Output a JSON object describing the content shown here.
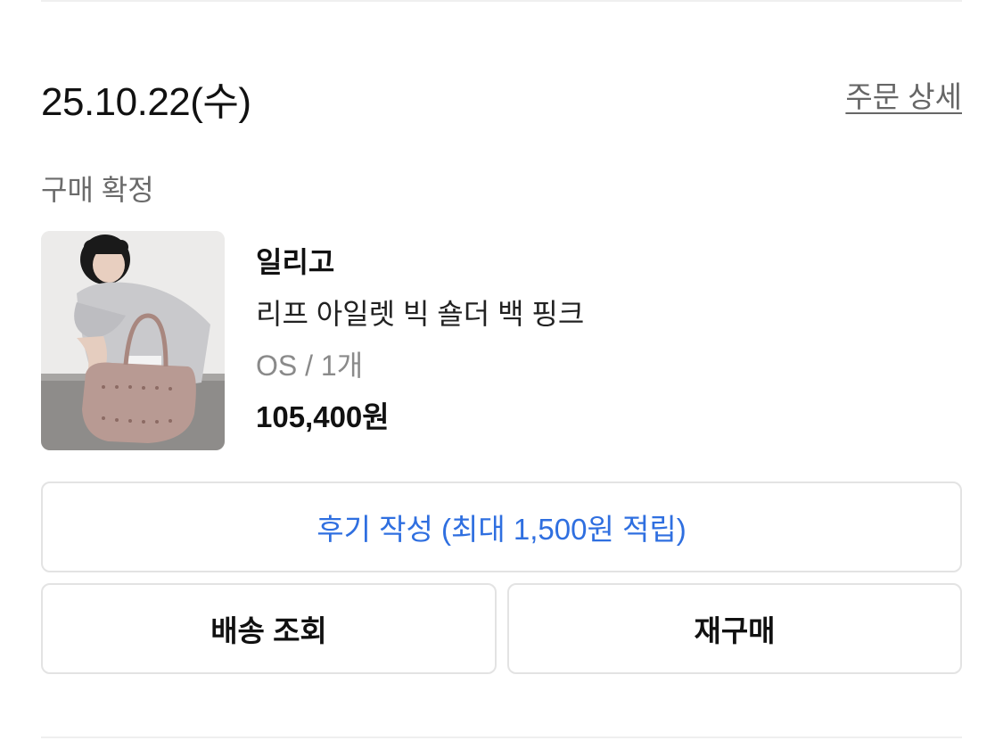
{
  "order": {
    "date": "25.10.22(수)",
    "detail_link": "주문 상세",
    "status": "구매 확정"
  },
  "product": {
    "image_icon": "product-photo",
    "brand": "일리고",
    "name": "리프 아일렛 빅 숄더 백 핑크",
    "option": "OS / 1개",
    "price": "105,400원"
  },
  "actions": {
    "review": "후기 작성 (최대 1,500원 적립)",
    "delivery": "배송 조회",
    "rebuy": "재구매"
  },
  "colors": {
    "accent": "#2f6fe0",
    "border": "#e3e3e3",
    "muted_text": "#6b6b6b"
  }
}
